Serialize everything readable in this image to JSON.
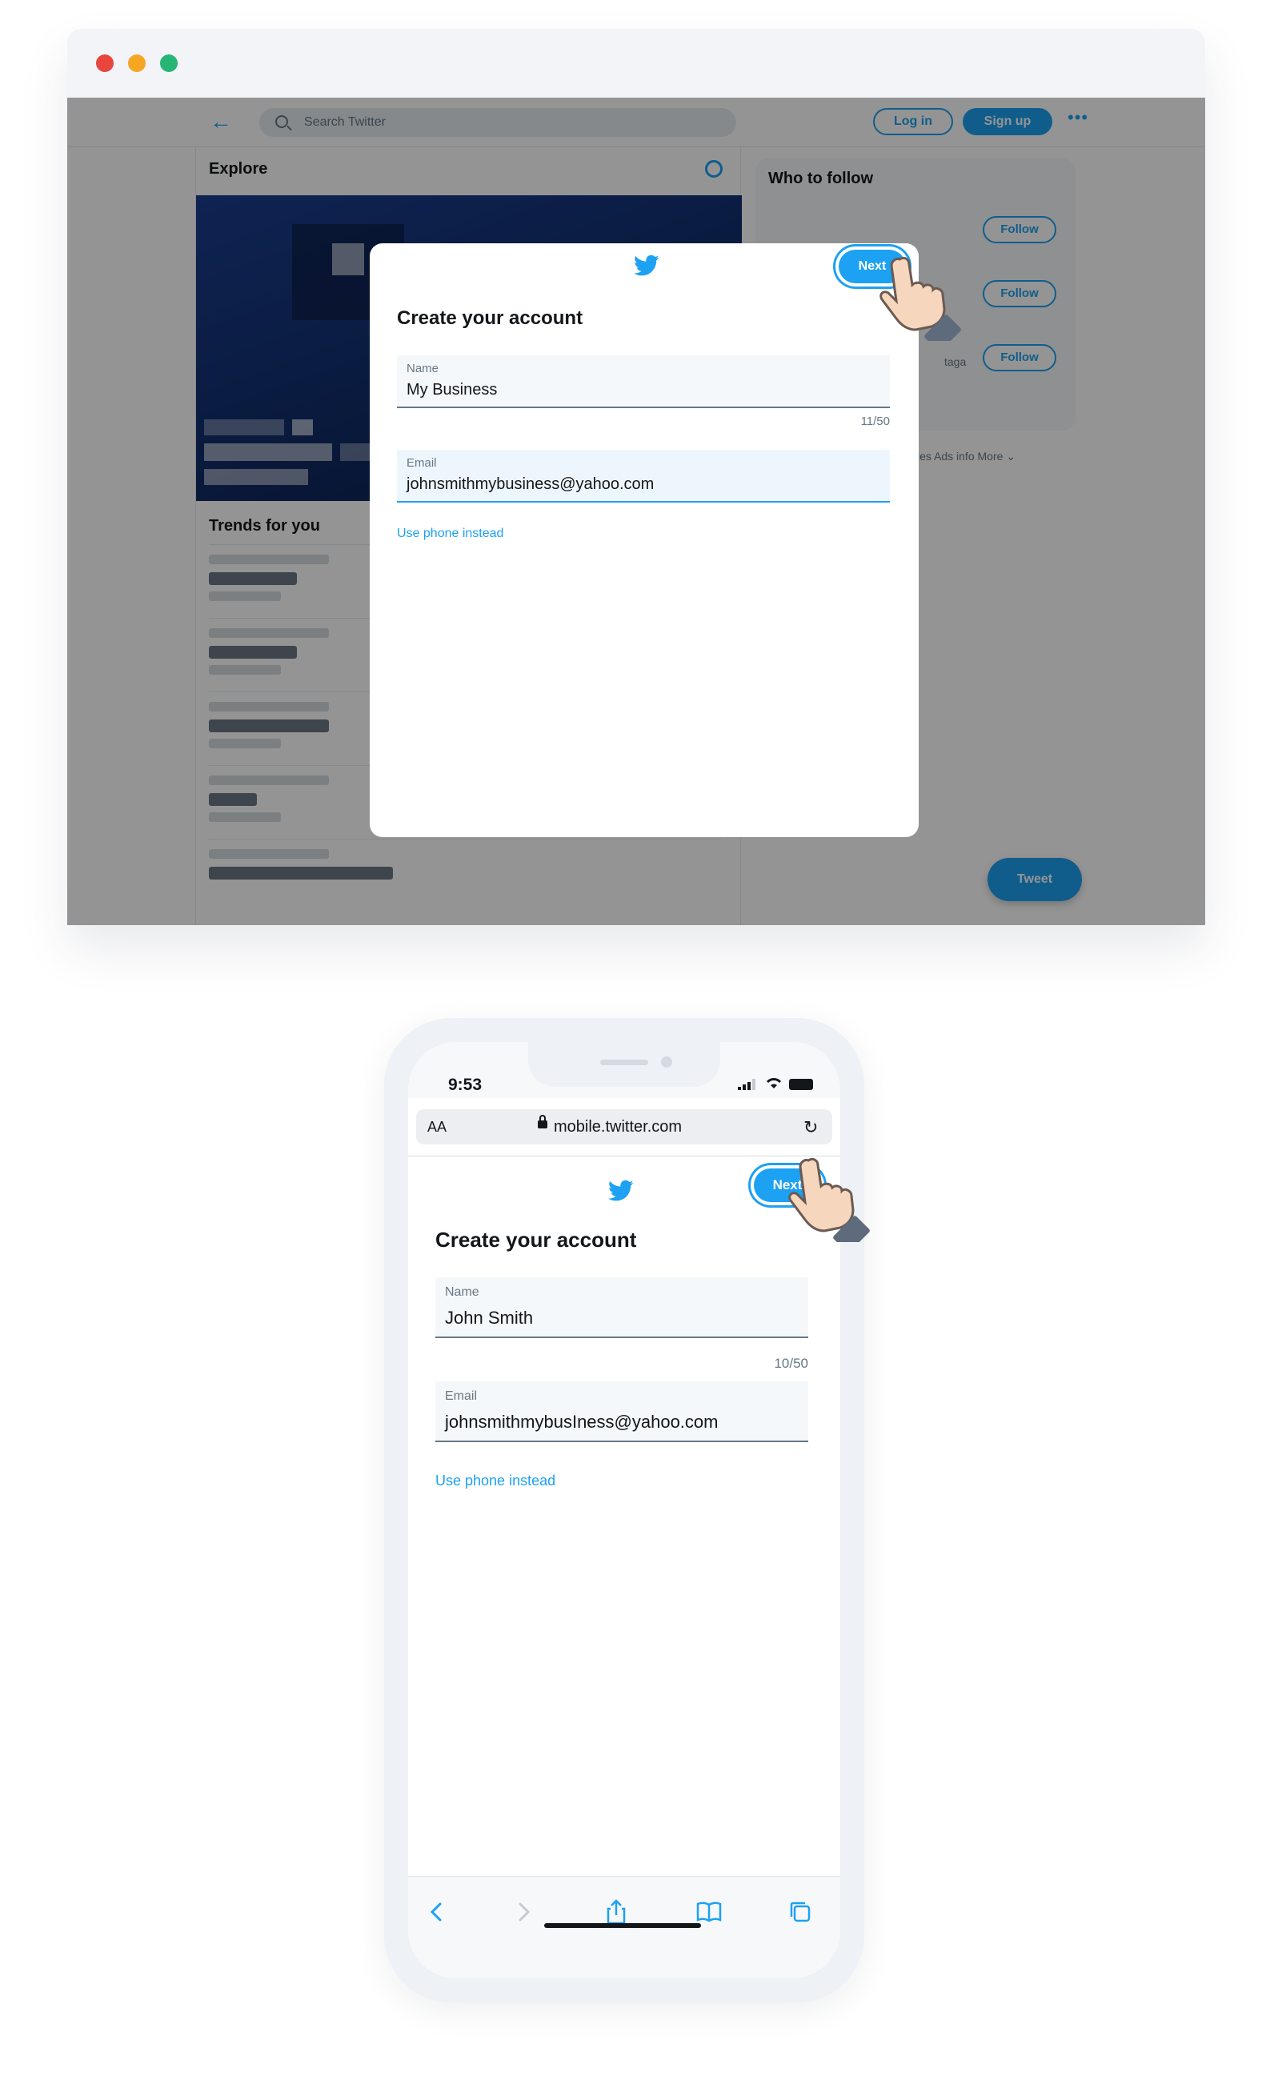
{
  "desktop": {
    "search_placeholder": "Search Twitter",
    "login_label": "Log in",
    "signup_label": "Sign up",
    "more_label": "•••",
    "explore_title": "Explore",
    "trends_title": "Trends for you",
    "who_to_follow_title": "Who to follow",
    "follow_label": "Follow",
    "partial_name_text": "taga",
    "footer_links": "ies  Ads info  More ⌄",
    "tweet_label": "Tweet",
    "modal": {
      "title": "Create your account",
      "next_label": "Next",
      "name_label": "Name",
      "name_value": "My Business",
      "name_counter": "11/50",
      "email_label": "Email",
      "email_value": "johnsmithmybusiness@yahoo.com",
      "phone_link": "Use phone instead"
    }
  },
  "mobile": {
    "time": "9:53",
    "url_aa": "AA",
    "url": "mobile.twitter.com",
    "next_label": "Next",
    "title": "Create your account",
    "name_label": "Name",
    "name_value": "John Smith",
    "name_counter": "10/50",
    "email_label": "Email",
    "email_value": "johnsmithmybusIness@yahoo.com",
    "phone_link": "Use phone instead"
  },
  "colors": {
    "twitter_blue": "#1da1f2",
    "traffic_red": "#e8453c",
    "traffic_yellow": "#f5a623",
    "traffic_green": "#26b574"
  },
  "icons": [
    "back-arrow-icon",
    "search-icon",
    "gear-icon",
    "twitter-bird-icon",
    "hand-pointer-icon",
    "lock-icon",
    "reload-icon",
    "chevron-left-icon",
    "chevron-right-icon",
    "share-icon",
    "bookmarks-icon",
    "tabs-icon"
  ]
}
